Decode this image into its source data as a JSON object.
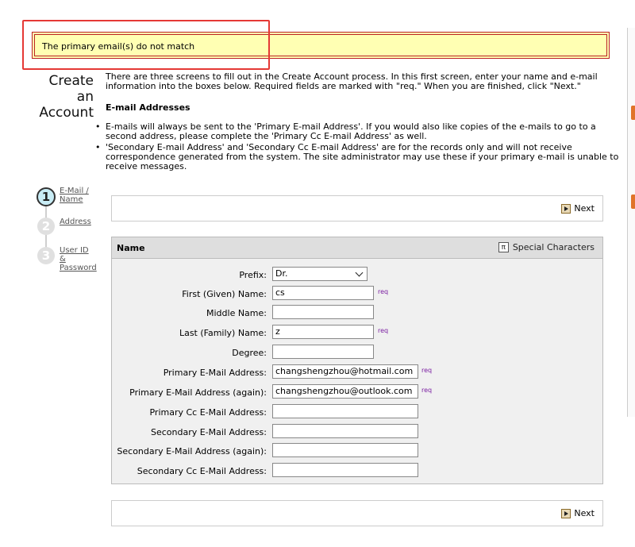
{
  "error": {
    "message": "The primary email(s) do not match"
  },
  "page": {
    "title_line1": "Create an",
    "title_line2": "Account",
    "intro": "There are three screens to fill out in the Create Account process. In this first screen, enter your name and e-mail information into the boxes below. Required fields are marked with \"req.\" When you are finished, click \"Next.\"",
    "email_heading": "E-mail Addresses",
    "bullets": [
      "E-mails will always be sent to the 'Primary E-mail Address'. If you would also like copies of the e-mails to go to a second address, please complete the 'Primary Cc E-mail Address' as well.",
      "'Secondary E-mail Address' and 'Secondary Cc E-mail Address' are for the records only and will not receive correspondence generated from the system. The site administrator may use these if your primary e-mail is unable to receive messages."
    ]
  },
  "steps": [
    {
      "number": "1",
      "line1": "E-Mail /",
      "line2": "Name",
      "active": true
    },
    {
      "number": "2",
      "line1": "Address",
      "active": false
    },
    {
      "number": "3",
      "line1": "User ID",
      "line2": "&",
      "line3": "Password",
      "active": false
    }
  ],
  "nav": {
    "next_label": "Next"
  },
  "name_panel": {
    "title": "Name",
    "special_chars_label": "Special Characters",
    "special_chars_icon": "π",
    "req_label": "req",
    "fields": {
      "prefix": {
        "label": "Prefix:",
        "value": "Dr."
      },
      "first": {
        "label": "First (Given) Name:",
        "value": "cs"
      },
      "middle": {
        "label": "Middle Name:",
        "value": ""
      },
      "last": {
        "label": "Last (Family) Name:",
        "value": "z"
      },
      "degree": {
        "label": "Degree:",
        "value": ""
      },
      "primary_email": {
        "label": "Primary E-Mail Address:",
        "value": "changshengzhou@hotmail.com"
      },
      "primary_email_again": {
        "label": "Primary E-Mail Address (again):",
        "value": "changshengzhou@outlook.com"
      },
      "primary_cc": {
        "label": "Primary Cc E-Mail Address:",
        "value": ""
      },
      "secondary_email": {
        "label": "Secondary E-Mail Address:",
        "value": ""
      },
      "secondary_email_again": {
        "label": "Secondary E-Mail Address (again):",
        "value": ""
      },
      "secondary_cc": {
        "label": "Secondary Cc E-Mail Address:",
        "value": ""
      }
    }
  }
}
